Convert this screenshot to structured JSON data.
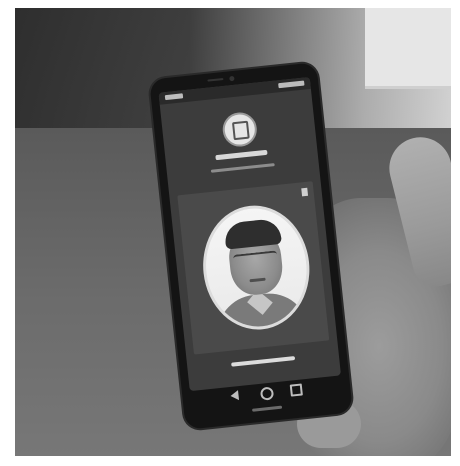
{
  "scene": {
    "colors": {
      "background": "#ffffff",
      "phone_body": "#141414",
      "screen": "#3c3c3c",
      "face_circle": "#f2f2f2"
    },
    "icons": [
      "app-logo-icon",
      "close-icon",
      "back-icon",
      "home-icon",
      "recent-apps-icon"
    ]
  }
}
